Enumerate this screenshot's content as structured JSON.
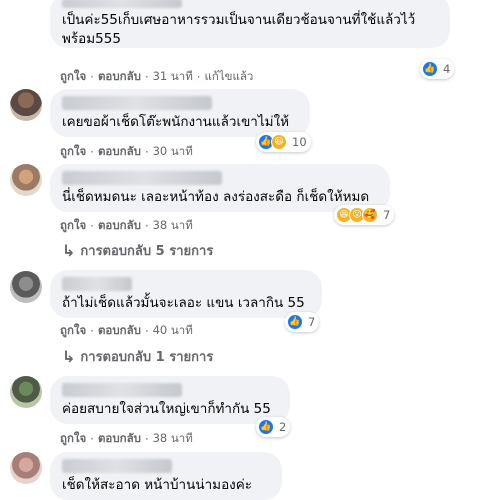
{
  "comments": [
    {
      "text": "เป็นค่ะ55เก็บเศษอาหารรวมเป็นจานเดียวช้อนจานที่ใช้แล้วไว้\nพร้อม555",
      "reactions": [
        "like"
      ],
      "reaction_count": "4",
      "like_label": "ถูกใจ",
      "reply_label": "ตอบกลับ",
      "time": "31 นาที",
      "edited": "แก้ไขแล้ว"
    },
    {
      "text": "เคยขอผ้าเช็ดโต๊ะพนักงานแล้วเขาไม่ให้",
      "reactions": [
        "like",
        "haha"
      ],
      "reaction_count": "10",
      "like_label": "ถูกใจ",
      "reply_label": "ตอบกลับ",
      "time": "30 นาที"
    },
    {
      "text": "นี่เช็ดหมดนะ เลอะหน้าท้อง ลงร่องสะดือ ก็เช็ดให้หมด",
      "reactions": [
        "haha",
        "wow",
        "care"
      ],
      "reaction_count": "7",
      "like_label": "ถูกใจ",
      "reply_label": "ตอบกลับ",
      "time": "38 นาที",
      "replies_label": "การตอบกลับ 5 รายการ"
    },
    {
      "text": "ถ้าไม่เช็ดแล้วมั้นจะเลอะ แขน เวลากิน 55",
      "reactions": [
        "like"
      ],
      "reaction_count": "7",
      "like_label": "ถูกใจ",
      "reply_label": "ตอบกลับ",
      "time": "40 นาที",
      "replies_label": "การตอบกลับ 1 รายการ"
    },
    {
      "text": "ค่อยสบายใจส่วนใหญ่เขาก็ทำกัน 55",
      "reactions": [
        "like"
      ],
      "reaction_count": "2",
      "like_label": "ถูกใจ",
      "reply_label": "ตอบกลับ",
      "time": "38 นาที"
    },
    {
      "text": "เช็ดให้สะอาด หน้าบ้านน่ามองค่ะ"
    }
  ],
  "colors": {
    "bubble": "#f0f2f5",
    "like": "#1877f2",
    "meta_text": "#65676b"
  }
}
